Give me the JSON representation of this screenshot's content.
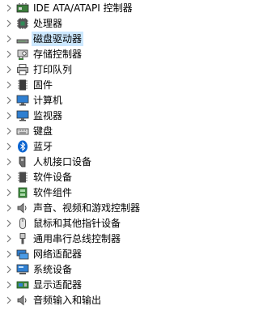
{
  "tree": {
    "items": [
      {
        "label": "IDE ATA/ATAPI 控制器",
        "icon": "ide-controller-icon"
      },
      {
        "label": "处理器",
        "icon": "processor-icon"
      },
      {
        "label": "磁盘驱动器",
        "icon": "disk-drive-icon",
        "selected": true
      },
      {
        "label": "存储控制器",
        "icon": "storage-controller-icon"
      },
      {
        "label": "打印队列",
        "icon": "printer-icon"
      },
      {
        "label": "固件",
        "icon": "firmware-icon"
      },
      {
        "label": "计算机",
        "icon": "computer-icon"
      },
      {
        "label": "监视器",
        "icon": "monitor-icon"
      },
      {
        "label": "键盘",
        "icon": "keyboard-icon"
      },
      {
        "label": "蓝牙",
        "icon": "bluetooth-icon"
      },
      {
        "label": "人机接口设备",
        "icon": "hid-icon"
      },
      {
        "label": "软件设备",
        "icon": "software-device-icon"
      },
      {
        "label": "软件组件",
        "icon": "software-component-icon"
      },
      {
        "label": "声音、视频和游戏控制器",
        "icon": "sound-icon"
      },
      {
        "label": "鼠标和其他指针设备",
        "icon": "mouse-icon"
      },
      {
        "label": "通用串行总线控制器",
        "icon": "usb-icon"
      },
      {
        "label": "网络适配器",
        "icon": "network-adapter-icon"
      },
      {
        "label": "系统设备",
        "icon": "system-device-icon"
      },
      {
        "label": "显示适配器",
        "icon": "display-adapter-icon"
      },
      {
        "label": "音频输入和输出",
        "icon": "audio-io-icon"
      }
    ]
  },
  "colors": {
    "selection": "#cce8ff",
    "chevron": "#7a7a7a",
    "bluetooth": "#0a64d0",
    "monitor_screen": "#2f7fd1"
  }
}
